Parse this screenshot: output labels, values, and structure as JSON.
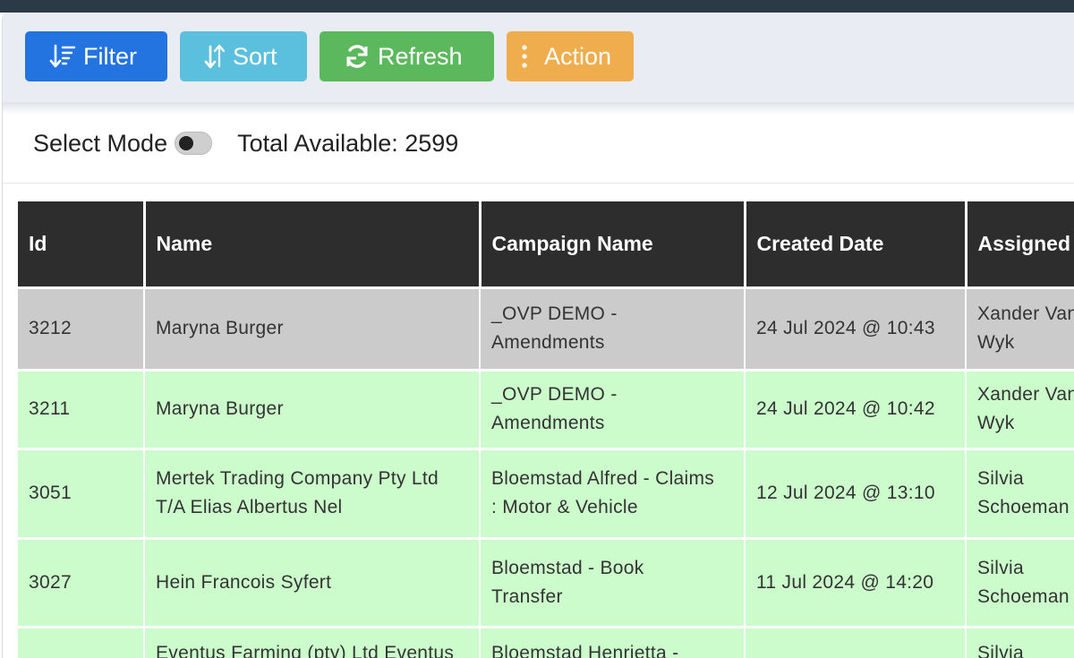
{
  "toolbar": {
    "filter_label": "Filter",
    "sort_label": "Sort",
    "refresh_label": "Refresh",
    "action_label": "Action"
  },
  "status": {
    "select_mode_label": "Select Mode",
    "total_available": "Total Available: 2599"
  },
  "table": {
    "headers": [
      "Id",
      "Name",
      "Campaign Name",
      "Created Date",
      "Assigned"
    ],
    "rows": [
      {
        "id": "3212",
        "name": [
          "Maryna Burger"
        ],
        "campaign": [
          "_OVP DEMO -",
          "Amendments"
        ],
        "created": "24 Jul 2024 @ 10:43",
        "assigned": [
          "Xander Van",
          "Wyk"
        ]
      },
      {
        "id": "3211",
        "name": [
          "Maryna Burger"
        ],
        "campaign": [
          "_OVP DEMO -",
          "Amendments"
        ],
        "created": "24 Jul 2024 @ 10:42",
        "assigned": [
          "Xander Van",
          "Wyk"
        ]
      },
      {
        "id": "3051",
        "name": [
          "Mertek Trading Company Pty Ltd",
          "T/A Elias Albertus Nel"
        ],
        "campaign": [
          "Bloemstad Alfred - Claims",
          ": Motor & Vehicle"
        ],
        "created": "12 Jul 2024 @ 13:10",
        "assigned": [
          "Silvia",
          "Schoeman"
        ]
      },
      {
        "id": "3027",
        "name": [
          "Hein Francois Syfert"
        ],
        "campaign": [
          "Bloemstad - Book",
          "Transfer"
        ],
        "created": "11 Jul 2024 @ 14:20",
        "assigned": [
          "Silvia",
          "Schoeman"
        ]
      },
      {
        "id": "",
        "name": [
          "Eventus Farming (pty) Ltd Eventus"
        ],
        "campaign": [
          "Bloemstad Henrietta -"
        ],
        "created": "",
        "assigned": [
          "Silvia"
        ]
      }
    ]
  },
  "colors": {
    "filter": "#2374e1",
    "sort": "#5bc0de",
    "refresh": "#5cb85c",
    "action": "#f0ad4e",
    "row_selected": "#cbcbcb",
    "row_green": "#ccfccc",
    "highlight": "#f07140"
  },
  "icons": {
    "filter": "filter-sort-icon",
    "sort": "sort-arrows-icon",
    "refresh": "refresh-icon",
    "action": "vertical-dots-icon"
  }
}
